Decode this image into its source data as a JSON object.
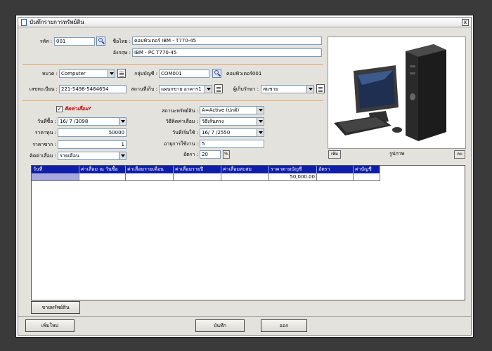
{
  "window": {
    "title": "บันทึกรายการทรัพย์สิน",
    "close": "x"
  },
  "asset": {
    "code_label": "รหัส :",
    "code_value": "001",
    "name_th_label": "ชื่อไทย :",
    "name_th_value": "คอมพิวเตอร์ IBM - T770-45",
    "name_en_label": "อังกฤษ :",
    "name_en_value": "IBM - PC T770-45"
  },
  "classification": {
    "category_label": "หมวด :",
    "category_value": "Computer",
    "account_group_label": "กลุ่มบัญชี :",
    "account_group_value": "COM001",
    "account_group_name": "คอมพิวเตอร์001",
    "serial_label": "เลขทะเบียน :",
    "serial_value": "221-5498-5464654",
    "location_label": "สถานที่เก็บ :",
    "location_value": "แผนกขาย อาคาร1",
    "custodian_label": "ผู้เก็บรักษา :",
    "custodian_value": "สมชาย"
  },
  "depreciation": {
    "calc_label": "คิดค่าเสื่อม?",
    "calc_checked": "✓",
    "purchase_date_label": "วันที่ซื้อ :",
    "purchase_date_value": "16/ 7 /3098",
    "cost_label": "ราคาทุน :",
    "cost_value": "50000",
    "salvage_label": "ราคาซาก :",
    "salvage_value": "1",
    "period_label": "คิดค่าเสื่อม :",
    "period_value": "รายเดือน",
    "status_label": "สถานะทรัพย์สิน :",
    "status_value": "A=Active (ปกติ)",
    "method_label": "วิธีคิดค่าเสื่อม :",
    "method_value": "วิธีเส้นตรง",
    "start_date_label": "วันที่เริ่มใช้ :",
    "start_date_value": "16/ 7 /2550",
    "life_label": "อายุการใช้งาน :",
    "life_value": "5",
    "rate_label": "อัตรา :",
    "rate_value": "20",
    "rate_unit": "%"
  },
  "photo": {
    "add_button": "เพิ่ม",
    "caption": "รูปภาพ",
    "delete_button": "ลบ"
  },
  "grid": {
    "columns": [
      "วันที่",
      "ค่าเสื่อม ณ วันซื้อ",
      "ค่าเสื่อมรายเดือน",
      "ค่าเสื่อมรายปี",
      "ค่าเสื่อมสะสม",
      "ราคาตามบัญชี",
      "อัตรา",
      "ค่าบัญชี"
    ],
    "rows": [
      [
        "",
        "",
        "",
        "",
        "",
        "50,000.00",
        "",
        ""
      ]
    ]
  },
  "buttons": {
    "sell": "ขายทรัพย์สิน",
    "new": "เพิ่มใหม่",
    "save": "บันทึก",
    "exit": "ออก"
  },
  "colors": {
    "grid_header": "#0f1ea8",
    "separator": "#e3a86a",
    "accent_red": "#c00000"
  }
}
